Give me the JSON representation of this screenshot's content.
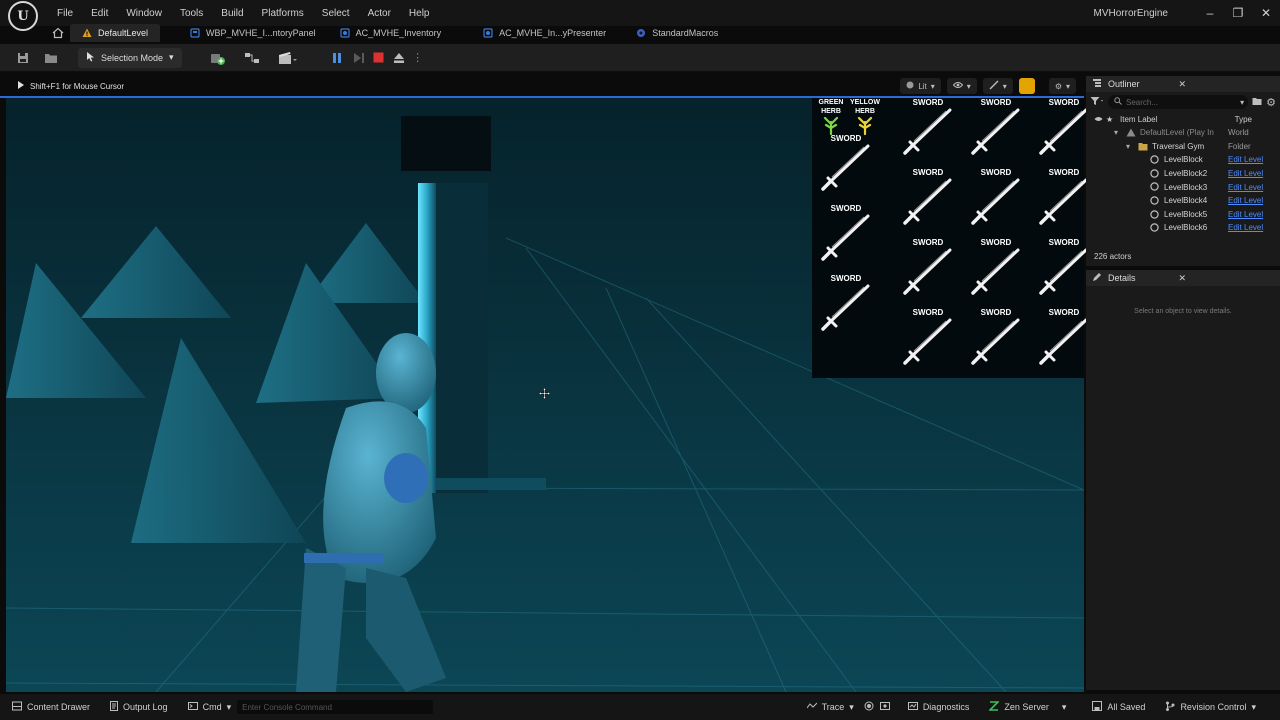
{
  "menu": {
    "items": [
      "File",
      "Edit",
      "Window",
      "Tools",
      "Build",
      "Platforms",
      "Select",
      "Actor",
      "Help"
    ]
  },
  "app": {
    "project_name": "MVHorrorEngine"
  },
  "tabs": [
    {
      "label": "DefaultLevel",
      "icon": "level-icon"
    },
    {
      "label": "WBP_MVHE_I...ntoryPanel",
      "icon": "widget-blueprint-icon"
    },
    {
      "label": "AC_MVHE_Inventory",
      "icon": "actor-component-icon"
    },
    {
      "label": "AC_MVHE_In...yPresenter",
      "icon": "actor-component-icon"
    },
    {
      "label": "StandardMacros",
      "icon": "macro-library-icon"
    }
  ],
  "toolbar": {
    "mode_label": "Selection Mode"
  },
  "viewport": {
    "hint": "Shift+F1 for Mouse Cursor",
    "view_mode": "Lit"
  },
  "inventory": {
    "slots": [
      {
        "label": "GREEN HERB",
        "kind": "herb",
        "color": "#7bd64a"
      },
      {
        "label": "YELLOW HERB",
        "kind": "herb",
        "color": "#e8d43a"
      },
      {
        "label": "SWORD",
        "kind": "sword"
      },
      {
        "label": "SWORD",
        "kind": "sword"
      },
      {
        "label": "SWORD",
        "kind": "sword"
      },
      {
        "label": "SWORD",
        "kind": "sword"
      },
      {
        "label": "SWORD",
        "kind": "sword"
      },
      {
        "label": "SWORD",
        "kind": "sword"
      },
      {
        "label": "SWORD",
        "kind": "sword"
      },
      {
        "label": "SWORD",
        "kind": "sword"
      },
      {
        "label": "SWORD",
        "kind": "sword"
      },
      {
        "label": "SWORD",
        "kind": "sword"
      },
      {
        "label": "SWORD",
        "kind": "sword"
      },
      {
        "label": "SWORD",
        "kind": "sword"
      },
      {
        "label": "SWORD",
        "kind": "sword"
      },
      {
        "label": "SWORD",
        "kind": "sword"
      },
      {
        "label": "SWORD",
        "kind": "sword"
      },
      {
        "label": "SWORD",
        "kind": "sword"
      },
      {
        "label": "SWORD",
        "kind": "sword"
      },
      {
        "label": "SWORD",
        "kind": "sword"
      }
    ]
  },
  "outliner": {
    "title": "Outliner",
    "search_placeholder": "Search...",
    "col_label": "Item Label",
    "col_type": "Type",
    "rows": [
      {
        "label": "DefaultLevel (Play In",
        "type": "World",
        "depth": 0,
        "kind": "world"
      },
      {
        "label": "Traversal Gym",
        "type": "Folder",
        "depth": 1,
        "kind": "folder"
      },
      {
        "label": "LevelBlock",
        "type": "Edit Level",
        "depth": 2,
        "kind": "actor"
      },
      {
        "label": "LevelBlock2",
        "type": "Edit Level",
        "depth": 2,
        "kind": "actor"
      },
      {
        "label": "LevelBlock3",
        "type": "Edit Level",
        "depth": 2,
        "kind": "actor"
      },
      {
        "label": "LevelBlock4",
        "type": "Edit Level",
        "depth": 2,
        "kind": "actor"
      },
      {
        "label": "LevelBlock5",
        "type": "Edit Level",
        "depth": 2,
        "kind": "actor"
      },
      {
        "label": "LevelBlock6",
        "type": "Edit Level",
        "depth": 2,
        "kind": "actor"
      }
    ],
    "actor_count": "226 actors"
  },
  "details": {
    "title": "Details",
    "empty_hint": "Select an object to view details."
  },
  "statusbar": {
    "content_drawer": "Content Drawer",
    "output_log": "Output Log",
    "cmd": "Cmd",
    "console_placeholder": "Enter Console Command",
    "trace": "Trace",
    "diagnostics": "Diagnostics",
    "zen_server": "Zen Server",
    "all_saved": "All Saved",
    "revision_control": "Revision Control"
  }
}
